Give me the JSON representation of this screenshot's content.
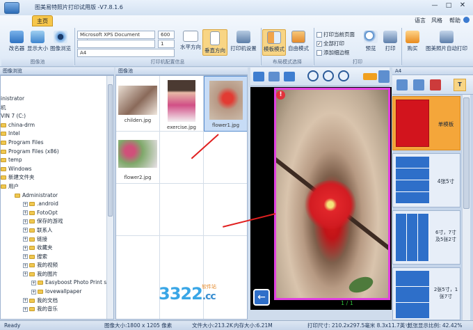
{
  "window": {
    "title": "图美易特照片打印试用版 -V7.8.1.6",
    "controls": [
      "—",
      "□",
      "✕"
    ]
  },
  "menu": {
    "tab_home": "主页",
    "language": "语言",
    "style": "风格",
    "help": "帮助"
  },
  "ribbon": {
    "group1": {
      "label": "图像池",
      "buttons": [
        "改名器",
        "显示大小",
        "图像浏览"
      ]
    },
    "group2": {
      "label": "打印机配置信息",
      "printer": "Microsoft XPS Document Writer",
      "dpi": "600",
      "copies": "1",
      "paper": "A4",
      "buttons": [
        "水平方向",
        "垂直方向",
        "打印机设置"
      ]
    },
    "group3": {
      "label": "布局模式选择",
      "buttons": [
        "模板模式",
        "自由模式"
      ]
    },
    "group4": {
      "label": "打印",
      "checks": [
        "打印当前页面",
        "全部打印",
        "添加细边框"
      ],
      "buttons": [
        "预览",
        "打印"
      ]
    },
    "group5": {
      "buttons": [
        "购买",
        "图美照片自动打印"
      ]
    }
  },
  "tree": {
    "header": "图像浏览",
    "items": [
      {
        "label": "inistrator",
        "indent": 0
      },
      {
        "label": "机",
        "indent": 0
      },
      {
        "label": "VIN 7 (C:)",
        "indent": 0
      },
      {
        "label": "china-drm",
        "indent": 0
      },
      {
        "label": "Intel",
        "indent": 0
      },
      {
        "label": "Program Files",
        "indent": 0
      },
      {
        "label": "Program Files (x86)",
        "indent": 0
      },
      {
        "label": "temp",
        "indent": 0
      },
      {
        "label": "Windows",
        "indent": 0
      },
      {
        "label": "新建文件夹",
        "indent": 0
      },
      {
        "label": "用户",
        "indent": 0
      },
      {
        "label": "Administrator",
        "indent": 1
      },
      {
        "label": ".android",
        "indent": 2
      },
      {
        "label": "FotoOpt",
        "indent": 2
      },
      {
        "label": "保存的游戏",
        "indent": 2
      },
      {
        "label": "联系人",
        "indent": 2
      },
      {
        "label": "链接",
        "indent": 2
      },
      {
        "label": "收藏夹",
        "indent": 2
      },
      {
        "label": "搜索",
        "indent": 2
      },
      {
        "label": "我的视频",
        "indent": 2
      },
      {
        "label": "我的图片",
        "indent": 2
      },
      {
        "label": "Easyboost Photo Print samp",
        "indent": 3
      },
      {
        "label": "lovewallpaper",
        "indent": 3
      },
      {
        "label": "我的文档",
        "indent": 2
      },
      {
        "label": "我的音乐",
        "indent": 2
      }
    ]
  },
  "pool": {
    "header": "图像池",
    "images": [
      {
        "name": "childen.jpg",
        "color": "#8a6a5a"
      },
      {
        "name": "exercise.jpg",
        "color": "#c9527a"
      },
      {
        "name": "flower1.jpg",
        "color": "#b83030"
      },
      {
        "name": "flower2.jpg",
        "color": "#c9507a"
      }
    ]
  },
  "canvas": {
    "page": "1 / 1"
  },
  "templates": {
    "header": "A4",
    "items": [
      "单模板",
      "4张5寸",
      "6寸，7寸\n及5张2寸",
      "2张5寸，1\n张7寸"
    ]
  },
  "watermark": {
    "text": "3322",
    "suffix": ".cc",
    "tag": "软件站"
  },
  "status": {
    "ready": "Ready",
    "image_size": "图像大小:1800 x 1205 像素",
    "file_size": "文件大小:213.2K",
    "mem_size": "内存大小:6.21M",
    "print_size": "打印尺寸: 210.2x297.5毫米  8.3x11.7英寸",
    "zoom": "纸张显示比例: 42.42%"
  },
  "colors": {
    "accent": "#f6c64a",
    "selected": "#c7dcf6",
    "template_active": "#f4a63a",
    "red": "#d2141d"
  }
}
